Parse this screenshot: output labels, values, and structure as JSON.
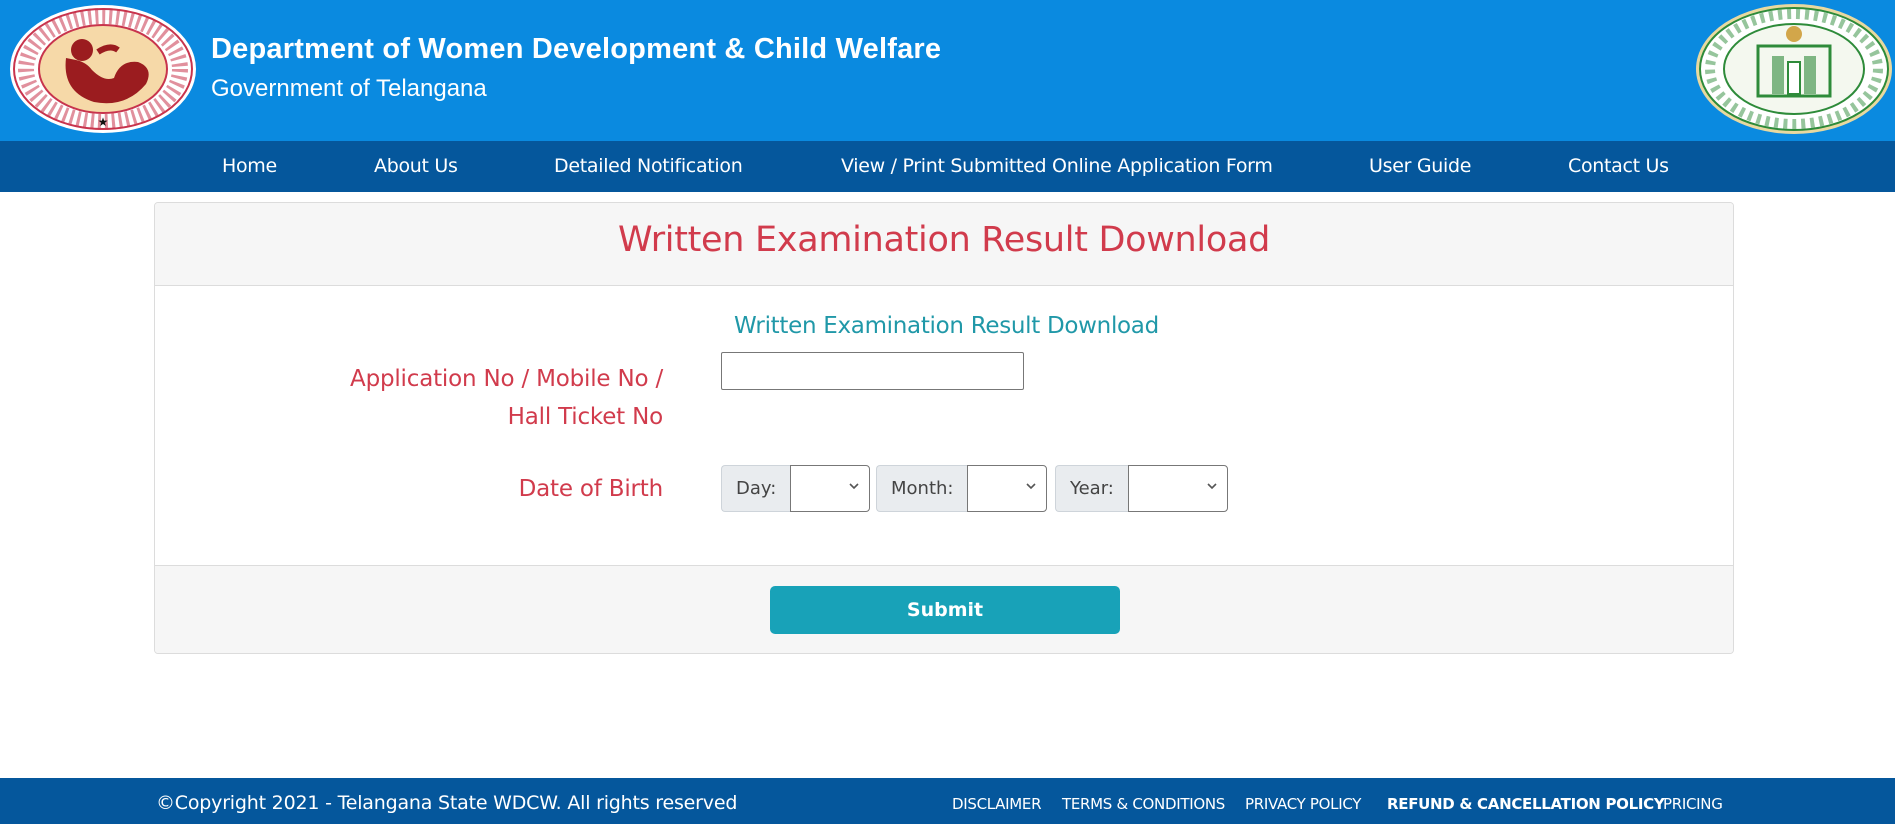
{
  "header": {
    "title": "Department of Women Development & Child Welfare",
    "subtitle": "Government of Telangana",
    "logo_left": "dept-women-development-logo",
    "logo_left_ring_text": "DEPT. OF WOMEN DEVELOPMENT & CHILD WELFARE",
    "logo_right": "government-of-telangana-seal",
    "logo_right_ring_text": "GOVERNMENT OF TELANGANA",
    "colors": {
      "header_bg": "#0a8ae0",
      "nav_bg": "#05579c"
    }
  },
  "nav": {
    "items": [
      {
        "label": "Home"
      },
      {
        "label": "About Us"
      },
      {
        "label": "Detailed Notification"
      },
      {
        "label": "View / Print Submitted Online Application Form"
      },
      {
        "label": "User Guide"
      },
      {
        "label": "Contact Us"
      }
    ]
  },
  "card": {
    "title": "Written Examination Result Download",
    "form_heading": "Written Examination Result Download",
    "fields": {
      "application_label_line1": "Application No / Mobile No /",
      "application_label_line2": "Hall Ticket No",
      "application_value": "",
      "dob_label": "Date of Birth",
      "day_label": "Day:",
      "day_value": "",
      "month_label": "Month:",
      "month_value": "",
      "year_label": "Year:",
      "year_value": ""
    },
    "submit_label": "Submit",
    "colors": {
      "title": "#d13b4c",
      "heading": "#2098a8",
      "button": "#18a2b8"
    }
  },
  "footer": {
    "copyright": "©Copyright 2021 - Telangana State WDCW. All rights reserved",
    "links": [
      {
        "label": "DISCLAIMER"
      },
      {
        "label": "TERMS & CONDITIONS"
      },
      {
        "label": "PRIVACY POLICY"
      },
      {
        "label": "REFUND & CANCELLATION POLICY"
      },
      {
        "label": "PRICING"
      }
    ]
  }
}
